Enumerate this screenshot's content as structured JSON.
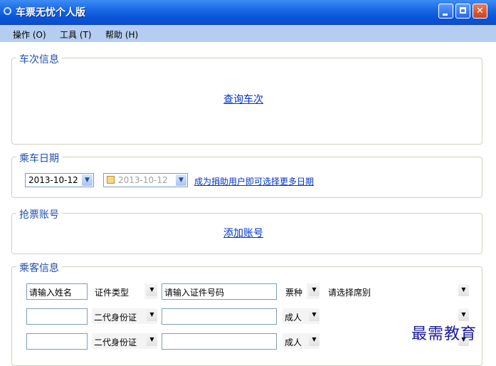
{
  "window": {
    "title": "车票无忧个人版"
  },
  "menu": [
    "操作 (O)",
    "工具 (T)",
    "帮助 (H)"
  ],
  "train_section": {
    "title": "车次信息",
    "query_link": "查询车次"
  },
  "date_section": {
    "title": "乘车日期",
    "date_value": "2013-10-12",
    "date2_value": "2013-10-12",
    "donate_link": "成为捐助用户即可选择更多日期"
  },
  "account_section": {
    "title": "抢票账号",
    "add_link": "添加账号"
  },
  "passenger_section": {
    "title": "乘客信息",
    "rows": [
      {
        "name": "请输入姓名",
        "id_type": "证件类型",
        "id_number": "请输入证件号码",
        "ticket_type": "票种",
        "seat": "请选择席别"
      },
      {
        "name": "",
        "id_type": "二代身份证",
        "id_number": "",
        "ticket_type": "成人",
        "seat": ""
      },
      {
        "name": "",
        "id_type": "二代身份证",
        "id_number": "",
        "ticket_type": "成人",
        "seat": ""
      }
    ]
  },
  "watermark": "最需教育",
  "colors": {
    "title_bar": "#0a55d8",
    "menu_bar": "#b5cdf0",
    "group_title": "#1f4fb0",
    "link": "#0033cc"
  }
}
